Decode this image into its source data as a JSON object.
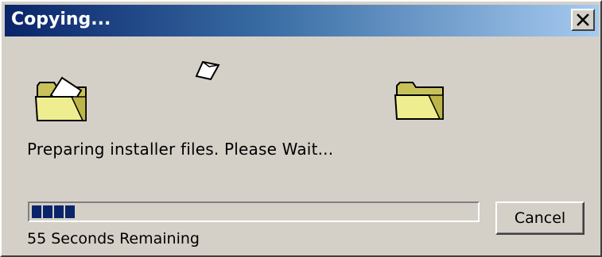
{
  "window": {
    "title": "Copying..."
  },
  "titlebar": {
    "close_icon": "close-icon",
    "gradient_start": "#0a246a",
    "gradient_end": "#a6caf0"
  },
  "animation": {
    "source_icon": "open-folder-icon",
    "destination_icon": "folder-icon",
    "moving_icon": "document-icon"
  },
  "status": {
    "message": "Preparing installer files.  Please Wait..."
  },
  "progress": {
    "fraction": 0.11,
    "color": "#0a246a"
  },
  "buttons": {
    "cancel_label": "Cancel"
  },
  "time_remaining": "55 Seconds Remaining"
}
